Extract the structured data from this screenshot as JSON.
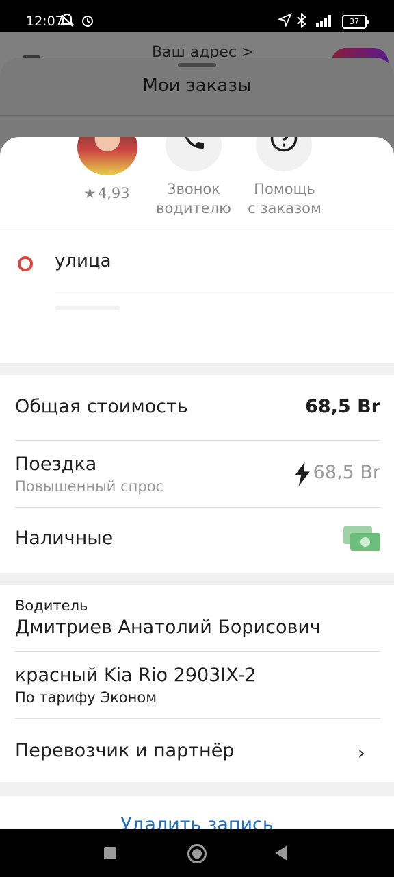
{
  "status_bar": {
    "time": "12:07",
    "battery": "37",
    "icons": [
      "muted-notifications-icon",
      "alarm-icon",
      "location-icon",
      "bluetooth-icon",
      "signal-icon",
      "battery-icon"
    ]
  },
  "background_app": {
    "address_label": "Ваш адрес >"
  },
  "orders_sheet": {
    "title": "Мои заказы"
  },
  "driver_actions": {
    "rating": "4,93",
    "call_label_line1": "Звонок",
    "call_label_line2": "водителю",
    "help_label_line1": "Помощь",
    "help_label_line2": "с заказом"
  },
  "route": {
    "origin": "улица"
  },
  "payment": {
    "total_label": "Общая стоимость",
    "total_value": "68,5 Br",
    "trip_label": "Поездка",
    "trip_sub": "Повышенный спрос",
    "trip_value": "68,5 Br",
    "method_label": "Наличные"
  },
  "driver": {
    "section_label": "Водитель",
    "name": "Дмитриев Анатолий Борисович",
    "car": "красный Kia Rio 2903IX-2",
    "tariff": "По тарифу Эконом",
    "partner_label": "Перевозчик и партнёр"
  },
  "actions": {
    "delete_label": "Удалить запись"
  },
  "colors": {
    "accent_link": "#1f6fc4",
    "route_origin": "#e0433b",
    "cash_icon": "#6cbf7a"
  }
}
